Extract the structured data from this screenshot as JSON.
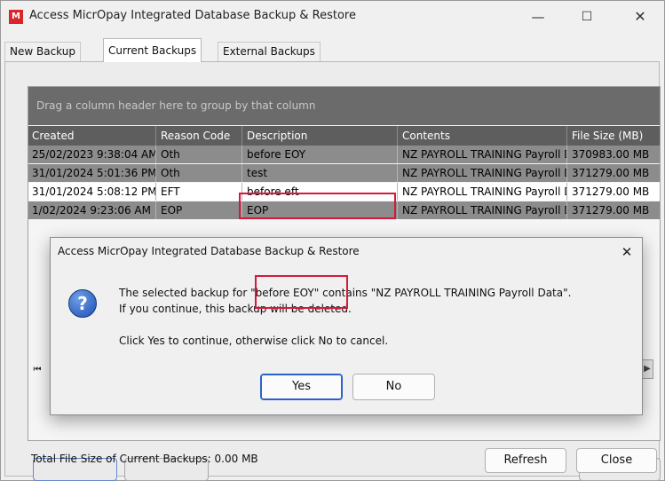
{
  "window": {
    "title": "Access MicrOpay Integrated Database Backup & Restore",
    "app_icon_letter": "M",
    "minimize_glyph": "—",
    "maximize_glyph": "☐",
    "close_glyph": "✕"
  },
  "tabs": [
    {
      "label": "New Backup",
      "active": false
    },
    {
      "label": "Current Backups",
      "active": true
    },
    {
      "label": "External Backups",
      "active": false
    }
  ],
  "grid": {
    "group_hint": "Drag a column header here to group by that column",
    "columns": [
      "Created",
      "Reason Code",
      "Description",
      "Contents",
      "File Size (MB)"
    ],
    "rows": [
      {
        "created": "25/02/2023 9:38:04 AM",
        "reason": "Oth",
        "description": "before EOY",
        "contents": "NZ PAYROLL TRAINING Payroll Data",
        "size": "370983.00 MB",
        "state": "dark"
      },
      {
        "created": "31/01/2024 5:01:36 PM",
        "reason": "Oth",
        "description": "test",
        "contents": "NZ PAYROLL TRAINING Payroll Data",
        "size": "371279.00 MB",
        "state": "dark"
      },
      {
        "created": "31/01/2024 5:08:12 PM",
        "reason": "EFT",
        "description": "before eft",
        "contents": "NZ PAYROLL TRAINING Payroll Data",
        "size": "371279.00 MB",
        "state": "selected"
      },
      {
        "created": "1/02/2024 9:23:06 AM",
        "reason": "EOP",
        "description": "EOP",
        "contents": "NZ PAYROLL TRAINING Payroll Data",
        "size": "371279.00 MB",
        "state": "dark"
      }
    ],
    "scroll_first_glyph": "⏮",
    "scroll_right_glyph": "▶"
  },
  "footer": {
    "total_label": "Total File Size of Current Backups: 0.00 MB",
    "refresh_label": "Refresh",
    "close_label": "Close"
  },
  "dialog": {
    "title": "Access MicrOpay Integrated Database Backup & Restore",
    "close_glyph": "✕",
    "icon_glyph": "?",
    "message_line1": "The selected backup for \"before EOY\" contains \"NZ PAYROLL TRAINING Payroll Data\".",
    "message_line2": "If you continue, this backup will be deleted.",
    "message_line3": "Click Yes to continue, otherwise click No to cancel.",
    "yes_label": "Yes",
    "no_label": "No"
  },
  "colors": {
    "highlight_border": "#d6193a",
    "grid_header_bg": "#5e5e5e",
    "row_dark_bg": "#8c8c8c",
    "row_selected_bg": "#ffffff",
    "app_icon_bg": "#d9262c"
  }
}
